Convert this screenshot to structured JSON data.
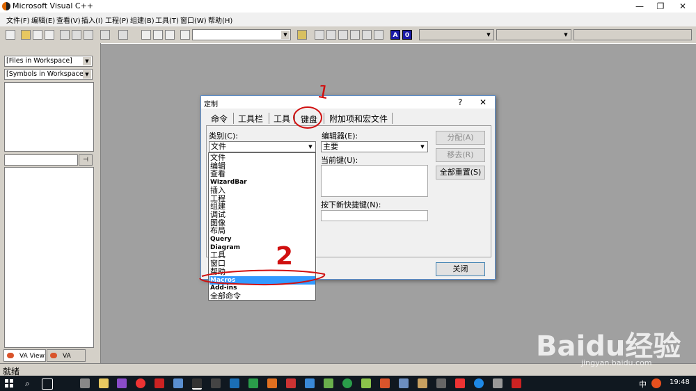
{
  "window": {
    "title": "Microsoft Visual C++",
    "minimize": "—",
    "restore": "❐",
    "close": "✕"
  },
  "menu": [
    "文件(F)",
    "编辑(E)",
    "查看(V)",
    "插入(I)",
    "工程(P)",
    "组建(B)",
    "工具(T)",
    "窗口(W)",
    "帮助(H)"
  ],
  "toolbar": {
    "blue_a": "A",
    "blue_0": "0"
  },
  "leftpane": {
    "combo1": "[Files in Workspace]",
    "combo2": "[Symbols in Workspace]",
    "tab1": "VA View",
    "tab2": "VA Outline"
  },
  "status": "就绪",
  "dialog": {
    "title": "定制",
    "help": "?",
    "close": "✕",
    "tabs": [
      "命令",
      "工具栏",
      "工具",
      "键盘",
      "附加项和宏文件"
    ],
    "category_label": "类别(C):",
    "category_value": "文件",
    "editor_label": "编辑器(E):",
    "editor_value": "主要",
    "current_keys_label": "当前键(U):",
    "new_shortcut_label": "按下新快捷键(N):",
    "btn_assign": "分配(A)",
    "btn_remove": "移去(R)",
    "btn_reset_all": "全部重置(S)",
    "btn_close": "关闭"
  },
  "category_list": [
    {
      "label": "文件",
      "en": false
    },
    {
      "label": "编辑",
      "en": false
    },
    {
      "label": "查看",
      "en": false
    },
    {
      "label": "WizardBar",
      "en": true
    },
    {
      "label": "插入",
      "en": false
    },
    {
      "label": "工程",
      "en": false
    },
    {
      "label": "组建",
      "en": false
    },
    {
      "label": "调试",
      "en": false
    },
    {
      "label": "图像",
      "en": false
    },
    {
      "label": "布局",
      "en": false
    },
    {
      "label": "Query",
      "en": true
    },
    {
      "label": "Diagram",
      "en": true
    },
    {
      "label": "工具",
      "en": false
    },
    {
      "label": "窗口",
      "en": false
    },
    {
      "label": "帮助",
      "en": false
    },
    {
      "label": "Macros",
      "en": true,
      "selected": true
    },
    {
      "label": "Add-ins",
      "en": true
    },
    {
      "label": "全部命令",
      "en": false
    }
  ],
  "annotations": {
    "num1": "1",
    "num2": "2"
  },
  "taskbar": {
    "time": "19:48",
    "ime": "中"
  },
  "watermark": {
    "text": "Baidu经验",
    "url": "jingyan.baidu.com"
  },
  "colors": {
    "accent": "#3399ff",
    "annotation": "#d01010",
    "taskbar": "#101820"
  }
}
